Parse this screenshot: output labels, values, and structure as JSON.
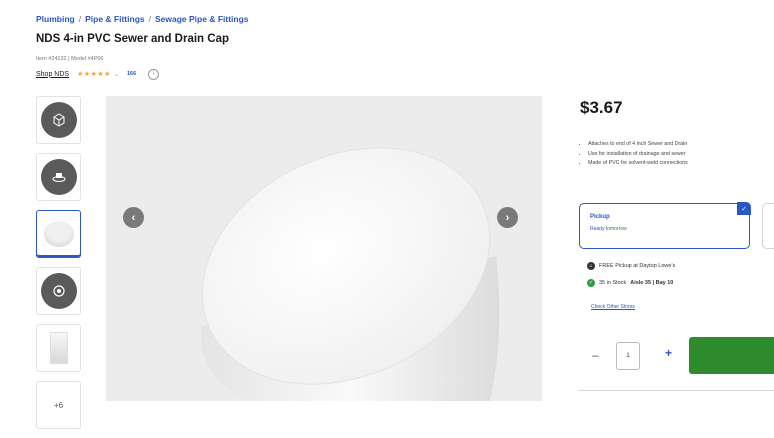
{
  "breadcrumb": {
    "items": [
      "Plumbing",
      "Pipe & Fittings",
      "Sewage Pipe & Fittings"
    ]
  },
  "product": {
    "title": "NDS 4-in PVC Sewer and Drain Cap",
    "meta": "Item #24132 | Model #4P06",
    "shop_link": "Shop NDS",
    "stars": "★★★★★",
    "reviews": "166",
    "price": "$3.67",
    "bullets": [
      "Attaches to end of 4 inch Sewer and Drain",
      "Use for installation of drainage and sewer",
      "Made of PVC for solvent-weld connections"
    ]
  },
  "gallery": {
    "more_label": "+6",
    "prev_icon": "chevron-left-icon",
    "next_icon": "chevron-right-icon"
  },
  "fulfillment": {
    "option_title": "Pickup",
    "option_sub_prefix": "Ready",
    "option_sub_status": "tomorrow",
    "free_pickup": "FREE Pickup at Daytop Lowe's",
    "stock_prefix": "35 in Stock",
    "stock_location": "Aisle 35 | Bay 10",
    "other_stores": "Check Other Stores"
  },
  "cart": {
    "quantity": "1",
    "minus": "–",
    "plus": "+"
  },
  "colors": {
    "accent": "#2a56c6",
    "add_button": "#2e8b2e",
    "stars": "#f5a623",
    "in_stock": "#2e9e44"
  }
}
